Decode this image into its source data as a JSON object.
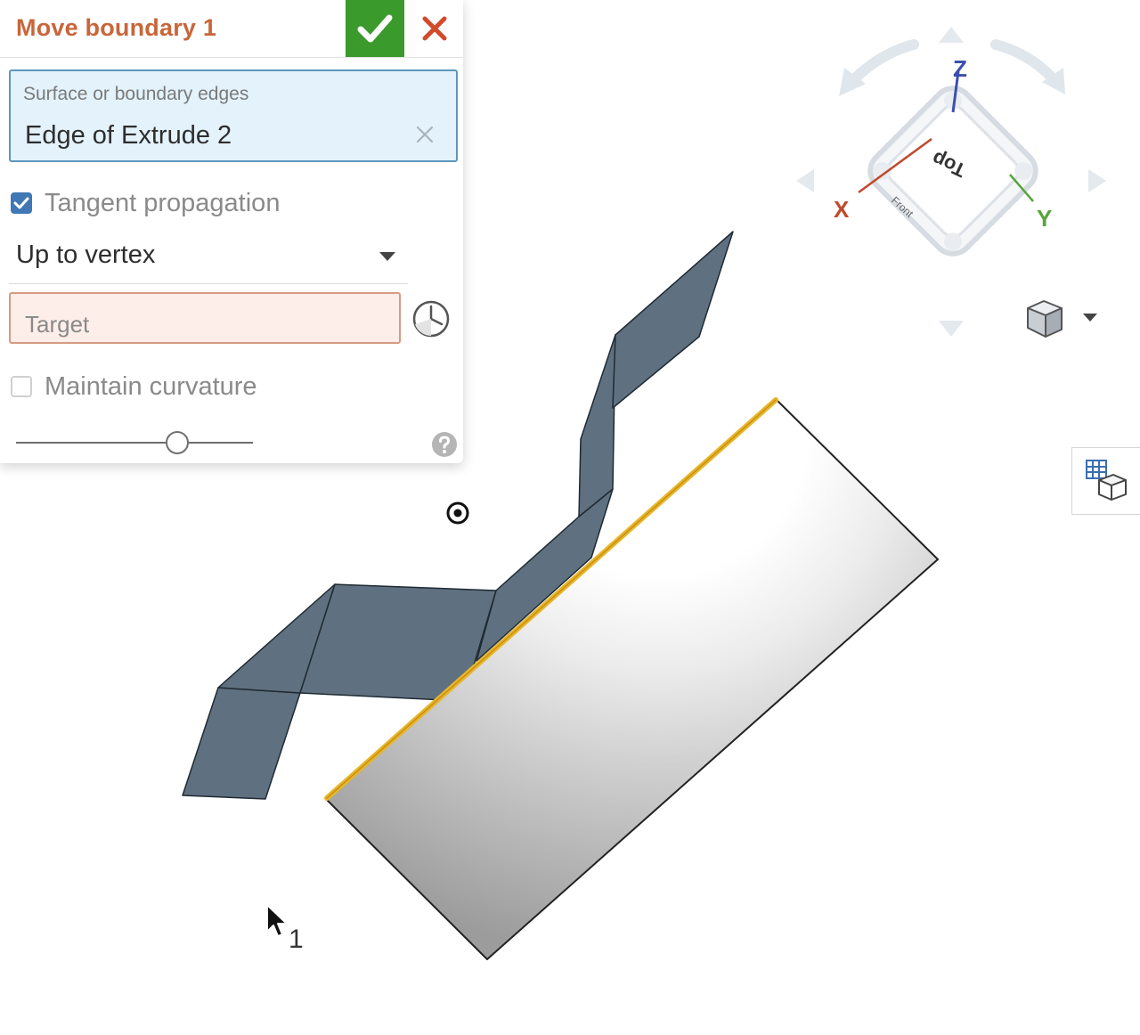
{
  "dialog": {
    "title": "Move boundary 1",
    "selection": {
      "label": "Surface or boundary edges",
      "value": "Edge of Extrude 2"
    },
    "tangent_propagation": {
      "label": "Tangent propagation",
      "checked": true
    },
    "end_type": {
      "selected": "Up to vertex"
    },
    "target": {
      "placeholder": "Target"
    },
    "maintain_curvature": {
      "label": "Maintain curvature",
      "checked": false
    },
    "slider": {
      "value": 0.68
    }
  },
  "viewcube": {
    "face_label": "Top",
    "side_label": "Front",
    "axes": {
      "x": "X",
      "y": "Y",
      "z": "Z"
    }
  },
  "cursor": {
    "badge": "1"
  },
  "colors": {
    "title": "#c8663a",
    "accept": "#3a9a2c",
    "cancel": "#d24a2a",
    "selection_bg": "#e3f2fb",
    "selection_border": "#5e97bd",
    "target_bg": "#fdeee9",
    "target_border": "#d59b82",
    "surface": "#5f7180",
    "selected_edge": "#e8b62a",
    "axis_x": "#c0492c",
    "axis_y": "#58a43b",
    "axis_z": "#3d4fae"
  },
  "icons": {
    "accept": "check-icon",
    "cancel": "close-icon",
    "clear": "clear-x-icon",
    "target": "clock-icon",
    "help": "help-icon",
    "view": "cube-icon",
    "caret": "chevron-down-icon",
    "pivot": "pivot-icon",
    "cursor": "mouse-pointer-icon",
    "side_tool": "grid-cube-icon"
  }
}
